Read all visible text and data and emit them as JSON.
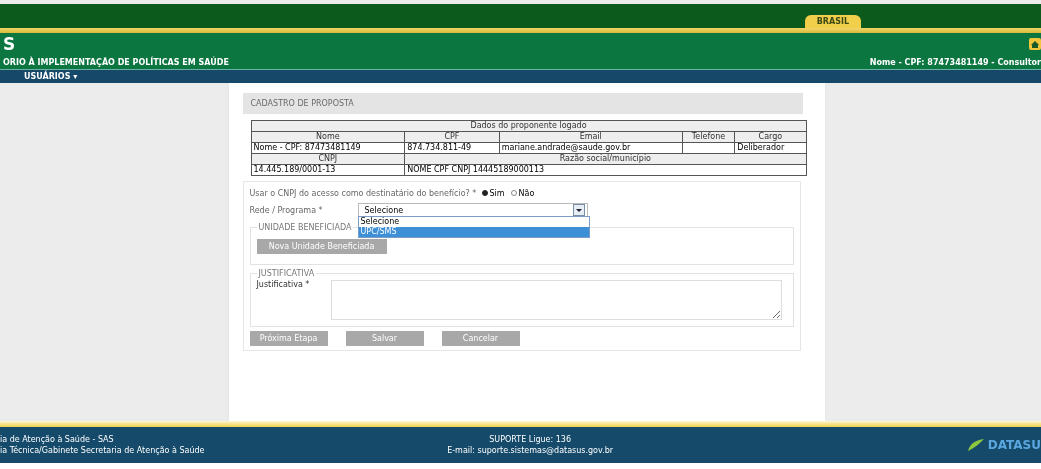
{
  "top_bar": {
    "badge": "BRASIL"
  },
  "header": {
    "title": "S",
    "subtitle": "ORIO À IMPLEMENTAÇÃO DE POLÍTICAS EM SAÚDE",
    "user": "Nome - CPF: 87473481149 - Consultor"
  },
  "nav": [
    {
      "label": "USUÁRIOS ▾"
    }
  ],
  "panel": {
    "title": "CADASTRO DE PROPOSTA",
    "proponent_table": {
      "caption": "Dados do proponente logado",
      "columns": [
        "Nome",
        "CPF",
        "Email",
        "Telefone",
        "Cargo"
      ],
      "row": {
        "nome": "Nome - CPF: 87473481149",
        "cpf": "874.734.811-49",
        "email": "mariane.andrade@saude.gov.br",
        "cargo": "Deliberador"
      },
      "columns_2": [
        "CNPJ",
        "Razão social/município"
      ],
      "row_2": [
        "14.445.189/0001-13",
        "NOME CPF CNPJ 14445189000113"
      ]
    },
    "cnpj_question": {
      "label": "Usar o CNPJ do acesso como destinatário do benefício? *",
      "options": [
        {
          "label": "Sim",
          "selected": true
        },
        {
          "label": "Não",
          "selected": false
        }
      ]
    },
    "program_select": {
      "label": "Rede / Programa *",
      "value": "Selecione",
      "options": [
        {
          "label": "Selecione",
          "highlighted": false
        },
        {
          "label": "UPC/SMS",
          "highlighted": true
        }
      ]
    },
    "unit_section": {
      "legend": "UNIDADE BENEFICIADA",
      "button": "Nova Unidade Beneficiada"
    },
    "justification_section": {
      "legend": "JUSTIFICATIVA",
      "label": "Justificativa *"
    },
    "buttons": [
      "Próxima Etapa",
      "Salvar",
      "Cancelar"
    ]
  },
  "footer": {
    "left": [
      "ia de Atenção à Saúde - SAS",
      "ia Técnica/Gabinete Secretaria de Atenção à Saúde"
    ],
    "center": [
      "SUPORTE Ligue: 136",
      "E-mail: suporte.sistemas@datasus.gov.br"
    ],
    "logo": "DATASU"
  }
}
